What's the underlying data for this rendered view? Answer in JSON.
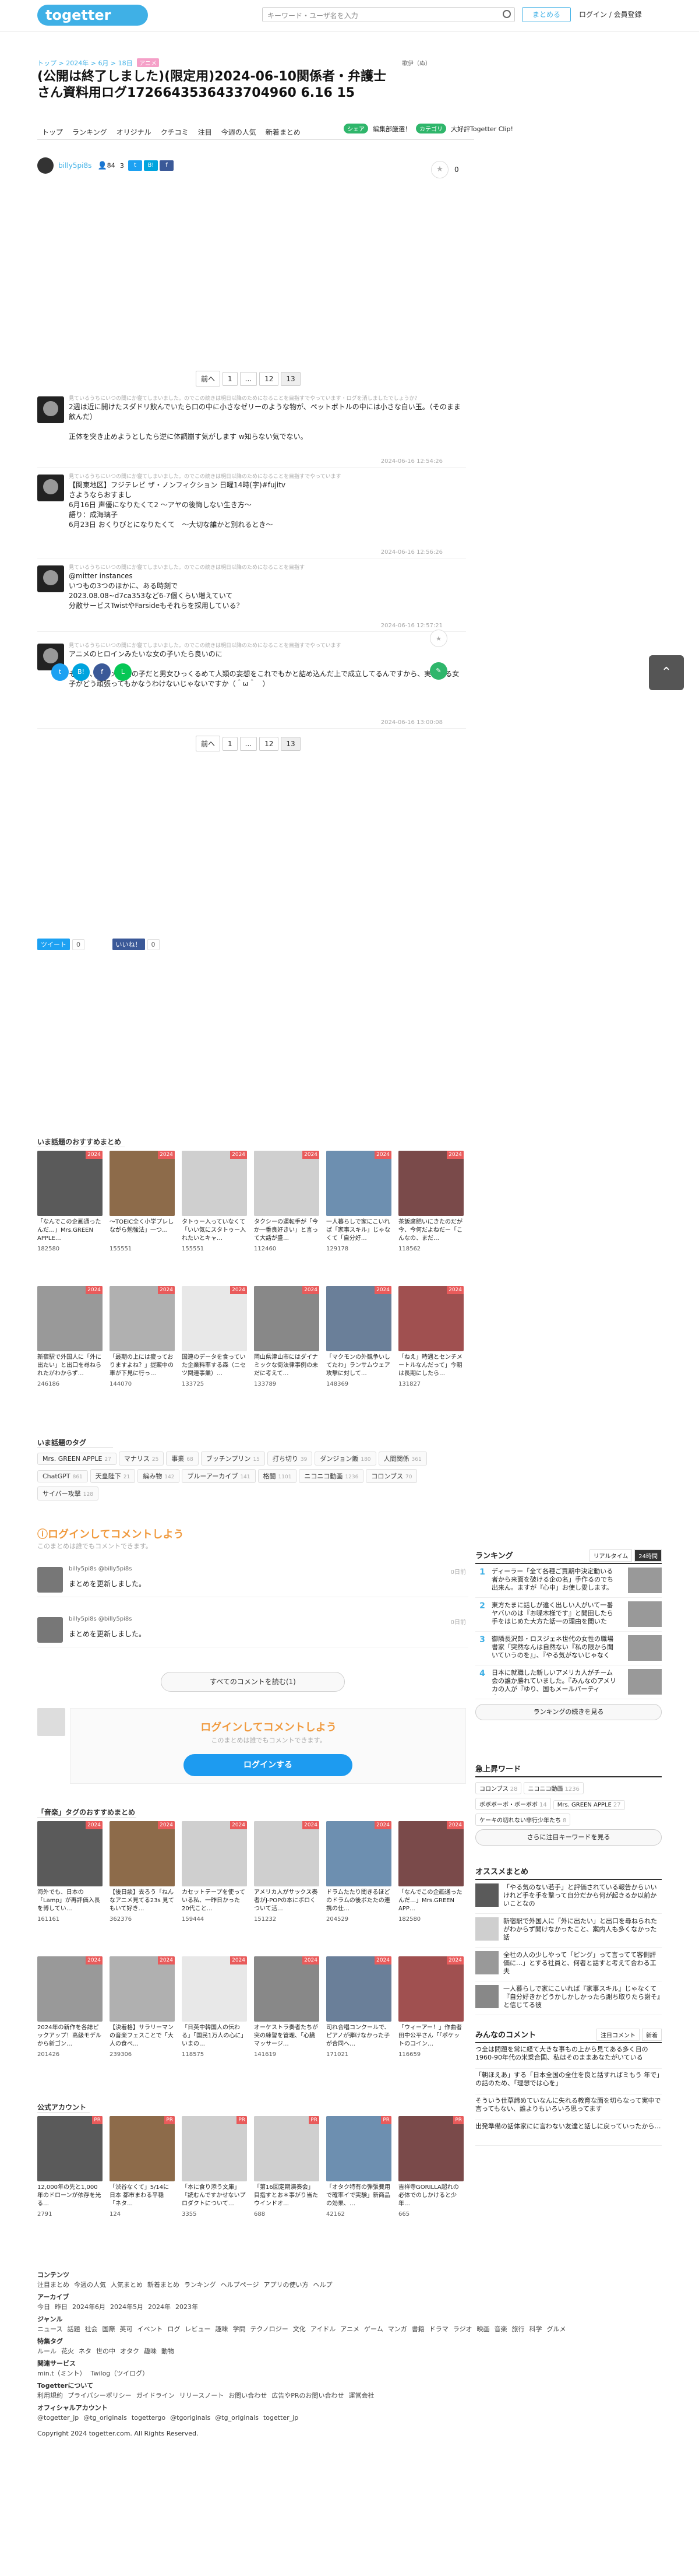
{
  "header": {
    "logo": "togetter",
    "search_placeholder": "キーワード・ユーザ名を入力",
    "make_button": "まとめる",
    "login": "ログイン / 会員登録"
  },
  "breadcrumb": {
    "items": [
      "トップ",
      "2024年",
      "6月",
      "18日"
    ],
    "badge": "アニメ"
  },
  "title": "(公開は終了しました)(限定用)2024-06-10関係者・弁護士さん資料用ログ1726643536433704960 6.16 15",
  "ad_label": "歌伊（ぬ）",
  "nav": {
    "tabs": [
      "トップ",
      "ランキング",
      "オリジナル",
      "クチコミ",
      "注目",
      "今週の人気",
      "新着まとめ"
    ],
    "sub": [
      "シェア",
      "編集部厳選！",
      "カテゴリ",
      "大好評Togetter Clip!"
    ]
  },
  "author": {
    "name": "billy5pi8s",
    "views": "84",
    "count": "3",
    "fav_count": "0",
    "fb": "f",
    "tw": "t",
    "hb": "B!"
  },
  "pager": {
    "prev": "前へ",
    "pages": [
      "1",
      "...",
      "12",
      "13"
    ],
    "current": "13"
  },
  "tweets": [
    {
      "meta": "見ているうちにいつの間にか寝てしまいました。のでこの続きは明日以降のためになることを目指すでやっています・ログを消しましたでしょうか？",
      "body": "2週は近に開けたスダドリ飲んでいたら口の中に小さなゼリーのような物が、ペットボトルの中には小さな白い玉。（そのまま飲んだ）\n\n正体を突き止めようとしたら逆に体調崩す気がします w知らない気でない。",
      "date": "2024-06-16 12:54:26"
    },
    {
      "meta": "見ているうちにいつの間にか寝てしまいました。のでこの続きは明日以降のためになることを目指すでやっています",
      "body": "【関東地区】フジテレビ ザ・ノンフィクション 日曜14時(字)#fujitv\nさようならおすまし\n6月16日 声優になりたくて2 〜アヤの後悔しない生き方〜\n語り：成海璃子\n6月23日 おくりびとになりたくて　〜大切な誰かと別れるとき〜",
      "date": "2024-06-16 12:56:26"
    },
    {
      "meta": "見ているうちにいつの間にか寝てしまいました。のでこの続きは明日以降のためになることを目指す",
      "body": "@mitter instances\nいつもの3つのほかに、ある時刻で\n2023.08.08~d7ca353など6-7個くらい増えていて\n分散サービスTwistやFarsideもそれらを採用している？",
      "date": "2024-06-16 12:57:21"
    },
    {
      "meta": "見ているうちにいつの間にか寝てしまいました。のでこの続きは明日以降のためになることを目指すでやっています",
      "body": "アニメのヒロインみたいな女の子いたら良いのに\n\nそりゃ、アニメの女の子だと男女ひっくるめて人類の妄想をこれでもかと詰め込んだ上で成立してるんですから、実在する女子がどう頑張ってもかなうわけないじゃないですか（＾ω＾　）",
      "date": "2024-06-16 13:00:08"
    }
  ],
  "share": {
    "tweet": "ツイート",
    "count": "0",
    "hatena": "いいね！",
    "hcount": "0"
  },
  "recommend": {
    "title": "いま話題のおすすめまとめ",
    "cards": [
      {
        "title": "「なんでこの企画通ったんだ…」Mrs.GREEN APPLE…",
        "count": "182580",
        "badge": "2024"
      },
      {
        "title": "～TOEIC全く小学プレしながら勉強法」一つ…",
        "count": "155551",
        "badge": "2024"
      },
      {
        "title": "タトゥー入っていなくて「いい気にスタトゥー入れたいとキャ…",
        "count": "155551",
        "badge": "2024"
      },
      {
        "title": "タクシーの運転手が「今か一番良好きい」と言って大話が盛…",
        "count": "112460",
        "badge": "2024"
      },
      {
        "title": "一人暮らしで家にこいれば「家事スキル」じゃなくて「自分好…",
        "count": "129178",
        "badge": "2024"
      },
      {
        "title": "茶飯腐肥いにきたのだが今、今何だよねだー「こんなの、まだ…",
        "count": "118562",
        "badge": "2024"
      },
      {
        "title": "新宿駅で外国人に「外に出たい」と出口を尋ねられたがわからず…",
        "count": "246186",
        "badge": "2024"
      },
      {
        "title": "「最期の上には疲っておりますよね？」提案中の車が下見に行っ…",
        "count": "144070",
        "badge": "2024"
      },
      {
        "title": "国連のデータを食っていた企業料率する森（ニセツ関連事業）…",
        "count": "133725",
        "badge": "2024"
      },
      {
        "title": "岡山県津山市にはダイナミックな街法律事例の未だに考えて…",
        "count": "133789",
        "badge": "2024"
      },
      {
        "title": "「マクモンの外観争いしてたわ」ランサムウェア攻撃に対して…",
        "count": "148369",
        "badge": "2024"
      },
      {
        "title": "「ねえ」時遇とセンチメートルなんだって」今朝は長期にしたら…",
        "count": "131827",
        "badge": "2024"
      }
    ]
  },
  "topic_tags": {
    "title": "いま話題のタグ",
    "tags": [
      {
        "name": "Mrs. GREEN APPLE",
        "n": "27"
      },
      {
        "name": "マナリス",
        "n": "25"
      },
      {
        "name": "事業",
        "n": "68"
      },
      {
        "name": "ブッチンプリン",
        "n": "15"
      },
      {
        "name": "打ち切り",
        "n": "39"
      },
      {
        "name": "ダンジョン飯",
        "n": "180"
      },
      {
        "name": "人間関係",
        "n": "361"
      },
      {
        "name": "ChatGPT",
        "n": "861"
      },
      {
        "name": "天皇陛下",
        "n": "21"
      },
      {
        "name": "編み物",
        "n": "142"
      },
      {
        "name": "ブルーアーカイブ",
        "n": "141"
      },
      {
        "name": "格闘",
        "n": "1101"
      },
      {
        "name": "ニコニコ動画",
        "n": "1236"
      },
      {
        "name": "コロンブス",
        "n": "70"
      },
      {
        "name": "サイバー攻撃",
        "n": "128"
      }
    ]
  },
  "comments": {
    "heading": "ログインしてコメントしよう",
    "sub": "このまとめは誰でもコメントできます。",
    "items": [
      {
        "name": "billy5pi8s @billy5pi8s",
        "body": "まとめを更新しました。",
        "date": "0日前"
      },
      {
        "name": "billy5pi8s @billy5pi8s",
        "body": "まとめを更新しました。",
        "date": "0日前"
      }
    ],
    "all": "すべてのコメントを読む(1)",
    "login_heading": "ログインしてコメントしよう",
    "login_sub": "このまとめは誰でもコメントできます。",
    "login_button": "ログインする"
  },
  "tag_recommend": {
    "title": "「音楽」タグのおすすめまとめ",
    "cards": [
      {
        "title": "海外でも、日本の「Lamp」が再評価入長を博してい…",
        "count": "161161",
        "badge": "2024"
      },
      {
        "title": "【後日談】去ろう「ねんなアニメ見てる23s 見てもいて好き…",
        "count": "362376",
        "badge": "2024"
      },
      {
        "title": "カセットテープを使っている私、一昨日かった20代こと…",
        "count": "159444",
        "badge": "2024"
      },
      {
        "title": "アメリカ人がサックス奏者がJ-POPの本にボロくついて活…",
        "count": "151232",
        "badge": "2024"
      },
      {
        "title": "ドラムたたり聞きるほどのドラムの後ボたたの連携の仕…",
        "count": "204529",
        "badge": "2024"
      },
      {
        "title": "「なんでこの企画通ったんだ…」Mrs.GREEN APP…",
        "count": "182580",
        "badge": "2024"
      },
      {
        "title": "2024年の新作を各誌ピックアップ！高級モデルから新ゴン…",
        "count": "201426",
        "badge": "2024"
      },
      {
        "title": "【決着格】サラリーマンの音楽フェスことで「大人の食べ…",
        "count": "239306",
        "badge": "2024"
      },
      {
        "title": "「日英中韓国人の伝わる」「国民1万人の心に」いまの…",
        "count": "118575",
        "badge": "2024"
      },
      {
        "title": "オーケストラ奏者たちが突の練習を管理、「心臓マッサージ…",
        "count": "141619",
        "badge": "2024"
      },
      {
        "title": "司れ合唱コンクールで、ピアノが弾けなかった子が合同へ…",
        "count": "171021",
        "badge": "2024"
      },
      {
        "title": "「ウィーアー！」作曲者田中公平さん「『ポケットのコイン…",
        "count": "116659",
        "badge": "2024"
      }
    ]
  },
  "official": {
    "title": "公式アカウント",
    "cards": [
      {
        "title": "12,000年の先と1,000年のドローンが依存を光る…",
        "count": "2791",
        "badge": "PR"
      },
      {
        "title": "「渋谷なくて」5/14に 日本 都市まわる平穏「ネタ…",
        "count": "124",
        "badge": "PR"
      },
      {
        "title": "「本に食り添う文庫」「読むんですかせないプロダクトについて…",
        "count": "3355",
        "badge": "PR"
      },
      {
        "title": "「第16回定期演奏会」目指すとお＊事がり当たウインドオ…",
        "count": "688",
        "badge": "PR"
      },
      {
        "title": "「オタク特有の弾張費用で確率イで実験」新商品の効果、…",
        "count": "42162",
        "badge": "PR"
      },
      {
        "title": "吉祥寺GORILLA超れの必体でのしかけると少年…",
        "count": "665",
        "badge": "PR"
      }
    ]
  },
  "ranking": {
    "title": "ランキング",
    "tabs": [
      "リアルタイム",
      "24時間"
    ],
    "items": [
      {
        "rank": "1",
        "title": "ディーラー「全て各種ご買期中決定動いる者から来面を破ける企の名」手作るのでち出来ん。ますが『心中」お使し愛します。"
      },
      {
        "rank": "2",
        "title": "東方たまに話しが違く出しい人がいて一番ヤバいのは『お喋木様です』と聞田したら手をはじめた大方た話一の理由を聞いた"
      },
      {
        "rank": "3",
        "title": "御隣長沢郎・ロスジェネ世代の女性の職場書家「突然なんは自然ない『私の限から聞いていうのを』」、『やる気がないじゃなくて』"
      },
      {
        "rank": "4",
        "title": "日本に就職した新しいアメリカ人がチーム会の誰か勝れていました。『みんなのアメリカの人が『ゆり、国もメールパーティさ…』」"
      }
    ],
    "more": "ランキングの続きを見る"
  },
  "keywords": {
    "title": "急上昇ワード",
    "items": [
      {
        "name": "コロンブス",
        "n": "28"
      },
      {
        "name": "ニコニコ動画",
        "n": "1236"
      },
      {
        "name": "ボボボーボ・ボーボボ",
        "n": "14"
      },
      {
        "name": "Mrs. GREEN APPLE",
        "n": "27"
      },
      {
        "name": "ケーキの切れない非行少年たち",
        "n": "8"
      }
    ],
    "more": "さらに注目キーワードを見る"
  },
  "osusume": {
    "title": "オススメまとめ",
    "items": [
      {
        "title": "「やる気のない若手」と評価されている報告からいいけれど手を手を撃って自分だから何が起きるか以前かいことなの"
      },
      {
        "title": "新宿駅で外国人に「外に出たい」と出口を尋ねられたがわからず聞けなかったこと、案内人も多くなかった話"
      },
      {
        "title": "全社の人の少しやって「ピング」って言ってて客側評価に…」とする社員と、何者と話すと考えて合わる工夫"
      },
      {
        "title": "一人暮らしで家にこいれば『家事スキル』じゃなくて『自分好きかどうかしかしかったら謝ち取りたら謝そ』と信じてる彼"
      }
    ]
  },
  "mina_comments": {
    "title": "みんなのコメント",
    "tabs": [
      "注目コメント",
      "新着"
    ],
    "items": [
      {
        "title": "つ全は問題を常に経て大きな事もの上から見てある多く日の1960-90年代の米乗合国、私はそのままあなたがいている"
      },
      {
        "title": "「朝ほえあ」する「日本全国の全住を良と話すればミもう 年で」の話のため、「理想では心を」"
      },
      {
        "title": "そういう仕草諦めていなんに失れる教育な面を切らなって実中で言ってもない、誰よりもいろいろ思ってます"
      },
      {
        "title": "出発準備の話体家にに言わない友達と話しに戻っていったから…"
      }
    ]
  },
  "footer": {
    "sections": [
      {
        "h": "コンテンツ",
        "items": [
          "注目まとめ",
          "今週の人気",
          "人気まとめ",
          "新着まとめ",
          "ランキング",
          "ヘルプページ",
          "アプリの使い方",
          "ヘルプ"
        ]
      },
      {
        "h": "アーカイブ",
        "items": [
          "今日",
          "昨日",
          "2024年6月",
          "2024年5月",
          "2024年",
          "2023年"
        ]
      },
      {
        "h": "ジャンル",
        "items": [
          "ニュース",
          "話題",
          "社会",
          "国際",
          "英可",
          "イベント",
          "ログ",
          "レビュー",
          "趣味",
          "学問",
          "テクノロジー",
          "文化",
          "アイドル",
          "アニメ",
          "ゲーム",
          "マンガ",
          "書籍",
          "ドラマ",
          "ラジオ",
          "映画",
          "音楽",
          "旅行",
          "科学",
          "グルメ"
        ]
      },
      {
        "h": "特集タグ",
        "items": [
          "ルール",
          "花火",
          "ネタ",
          "世の中",
          "オタク",
          "趣味",
          "動物"
        ]
      },
      {
        "h": "関連サービス",
        "items": [
          "min.t（ミント）",
          "Twilog（ツイログ）"
        ]
      },
      {
        "h": "Togetterについて",
        "items": [
          "利用規約",
          "プライバシーポリシー",
          "ガイドライン",
          "リリースノート",
          "お問い合わせ",
          "広告やPRのお問い合わせ",
          "運営会社"
        ]
      },
      {
        "h": "オフィシャルアカウント",
        "items": [
          "@togetter_jp",
          "@tg_originals",
          "togettergo",
          "@tgoriginals",
          "@tg_originals",
          "togetter_jp"
        ]
      }
    ],
    "copyright": "Copyright 2024 togetter.com. All Rights Reserved."
  }
}
